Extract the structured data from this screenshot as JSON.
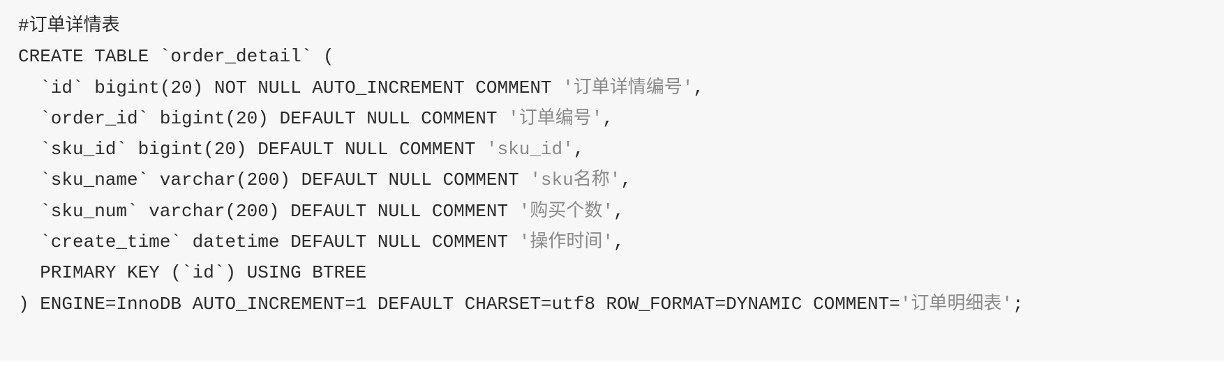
{
  "code": {
    "language": "sql",
    "lines": [
      [
        {
          "t": "#订单详情表",
          "s": false
        }
      ],
      [
        {
          "t": "CREATE TABLE `order_detail` (",
          "s": false
        }
      ],
      [
        {
          "t": "  `id` bigint(20) NOT NULL AUTO_INCREMENT COMMENT ",
          "s": false
        },
        {
          "t": "'订单详情编号'",
          "s": true
        },
        {
          "t": ",",
          "s": false
        }
      ],
      [
        {
          "t": "  `order_id` bigint(20) DEFAULT NULL COMMENT ",
          "s": false
        },
        {
          "t": "'订单编号'",
          "s": true
        },
        {
          "t": ",",
          "s": false
        }
      ],
      [
        {
          "t": "  `sku_id` bigint(20) DEFAULT NULL COMMENT ",
          "s": false
        },
        {
          "t": "'sku_id'",
          "s": true
        },
        {
          "t": ",",
          "s": false
        }
      ],
      [
        {
          "t": "  `sku_name` varchar(200) DEFAULT NULL COMMENT ",
          "s": false
        },
        {
          "t": "'sku名称'",
          "s": true
        },
        {
          "t": ",",
          "s": false
        }
      ],
      [
        {
          "t": "  `sku_num` varchar(200) DEFAULT NULL COMMENT ",
          "s": false
        },
        {
          "t": "'购买个数'",
          "s": true
        },
        {
          "t": ",",
          "s": false
        }
      ],
      [
        {
          "t": "  `create_time` datetime DEFAULT NULL COMMENT ",
          "s": false
        },
        {
          "t": "'操作时间'",
          "s": true
        },
        {
          "t": ",",
          "s": false
        }
      ],
      [
        {
          "t": "  PRIMARY KEY (`id`) USING BTREE",
          "s": false
        }
      ],
      [
        {
          "t": ") ENGINE=InnoDB AUTO_INCREMENT=1 DEFAULT CHARSET=utf8 ROW_FORMAT=DYNAMIC COMMENT=",
          "s": false
        },
        {
          "t": "'订单明细表'",
          "s": true
        },
        {
          "t": ";",
          "s": false
        }
      ]
    ]
  }
}
